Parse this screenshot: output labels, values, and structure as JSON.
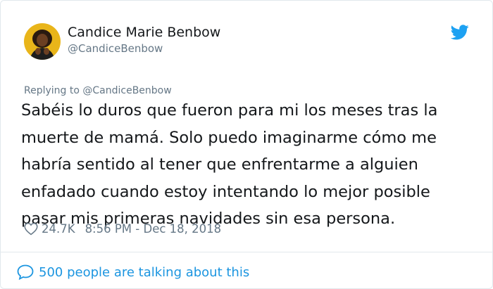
{
  "tweet": {
    "author_name": "Candice Marie Benbow",
    "author_handle": "@CandiceBenbow",
    "replying_prefix": "Replying to",
    "replying_to": "@CandiceBenbow",
    "text_lines": [
      "Sabéis lo duros que fueron para mi los meses tras la",
      "muerte de mamá. Solo puedo imaginarme cómo me",
      "habría sentido al tener que enfrentarme a alguien",
      "enfadado cuando estoy intentando lo mejor posible",
      "pasar mis primeras navidades sin esa persona."
    ],
    "likes": "24.7K",
    "timestamp": "8:56 PM - Dec 18, 2018",
    "talking": "500 people are talking about this"
  },
  "icons": {
    "brand": "twitter-bird-icon",
    "like": "heart-icon",
    "reply": "speech-bubble-icon"
  },
  "colors": {
    "twitter_blue": "#1da1f2",
    "link_blue": "#1b95e0",
    "secondary_text": "#657786",
    "primary_text": "#14171a",
    "avatar_bg": "#e9b51a"
  }
}
